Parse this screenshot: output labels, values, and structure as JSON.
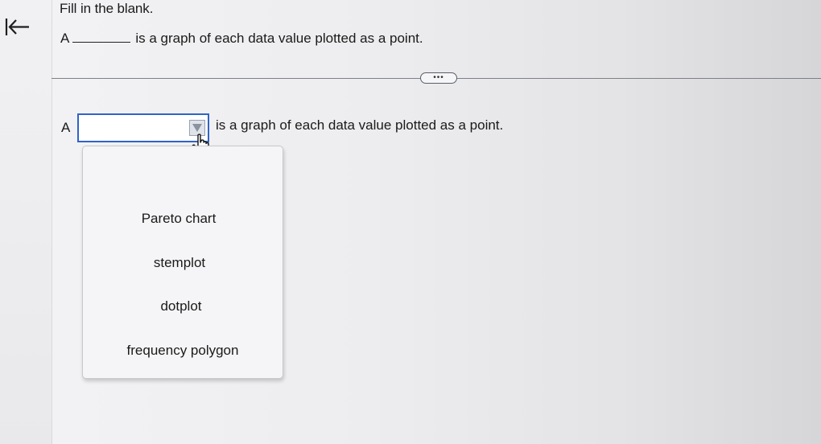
{
  "nav": {
    "back_icon": "first-page-arrow-icon"
  },
  "question": {
    "instruction": "Fill in the blank.",
    "prefix": "A",
    "suffix": "is a graph of each data value plotted as a point."
  },
  "toolbar": {
    "more_label": "•••"
  },
  "answer": {
    "prefix": "A",
    "selected_value": "",
    "suffix": "is a graph of each data value plotted as a point.",
    "arrow_icon": "chevron-down-icon"
  },
  "dropdown": {
    "options": [
      "Pareto chart",
      "stemplot",
      "dotplot",
      "frequency polygon"
    ]
  },
  "colors": {
    "accent": "#2f64c8"
  }
}
